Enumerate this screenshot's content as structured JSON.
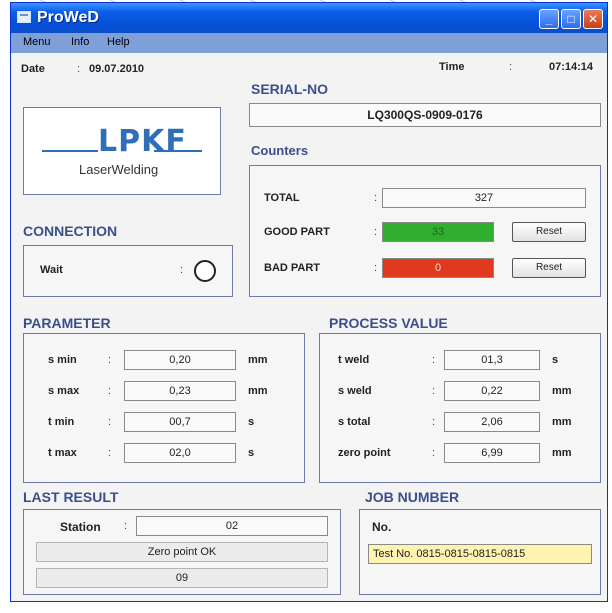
{
  "window": {
    "title": "ProWeD"
  },
  "menu": {
    "items": [
      "Menu",
      "Info",
      "Help"
    ]
  },
  "date": {
    "label": "Date",
    "value": "09.07.2010"
  },
  "time": {
    "label": "Time",
    "value": "07:14:14"
  },
  "logo": {
    "brand": "LPKF",
    "subtitle": "LaserWelding"
  },
  "serial": {
    "heading": "SERIAL-NO",
    "value": "LQ300QS-0909-0176"
  },
  "counters": {
    "heading": "Counters",
    "total_label": "TOTAL",
    "total_value": "327",
    "good_label": "GOOD PART",
    "good_value": "33",
    "bad_label": "BAD PART",
    "bad_value": "0",
    "reset_label": "Reset",
    "good_color": "#2fae2f",
    "bad_color": "#e03a1e"
  },
  "connection": {
    "heading": "CONNECTION",
    "status_label": "Wait"
  },
  "parameter": {
    "heading": "PARAMETER",
    "rows": [
      {
        "label": "s min",
        "value": "0,20",
        "unit": "mm"
      },
      {
        "label": "s max",
        "value": "0,23",
        "unit": "mm"
      },
      {
        "label": "t min",
        "value": "00,7",
        "unit": "s"
      },
      {
        "label": "t max",
        "value": "02,0",
        "unit": "s"
      }
    ]
  },
  "process": {
    "heading": "PROCESS VALUE",
    "rows": [
      {
        "label": "t weld",
        "value": "01,3",
        "unit": "s"
      },
      {
        "label": "s weld",
        "value": "0,22",
        "unit": "mm"
      },
      {
        "label": "s total",
        "value": "2,06",
        "unit": "mm"
      },
      {
        "label": "zero point",
        "value": "6,99",
        "unit": "mm"
      }
    ]
  },
  "last_result": {
    "heading": "LAST RESULT",
    "station_label": "Station",
    "station_value": "02",
    "message": "Zero point OK",
    "code": "09"
  },
  "job": {
    "heading": "JOB NUMBER",
    "no_label": "No.",
    "value": "Test No. 0815-0815-0815-0815"
  },
  "colors": {
    "title_bar": "#0a5fe8",
    "menu_bar": "#7f9fd8",
    "heading": "#3b4f8c",
    "job_field": "#fff3b0"
  }
}
